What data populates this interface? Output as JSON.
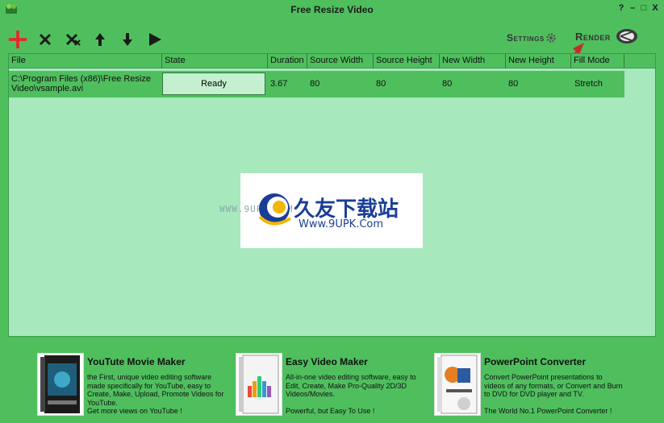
{
  "window": {
    "title": "Free Resize Video",
    "controls": [
      "?",
      "–",
      "□",
      "X"
    ]
  },
  "toolbar": {
    "buttons": [
      {
        "name": "add-icon",
        "color": "#e8282a"
      },
      {
        "name": "remove-icon"
      },
      {
        "name": "remove-all-icon"
      },
      {
        "name": "move-up-icon"
      },
      {
        "name": "move-down-icon"
      },
      {
        "name": "play-icon"
      }
    ],
    "settings_label": "Settings",
    "render_label": "Render"
  },
  "grid": {
    "columns": [
      "File",
      "State",
      "Duration",
      "Source Width",
      "Source Height",
      "New Width",
      "New Height",
      "Fill Mode"
    ],
    "rows": [
      {
        "file": "C:\\Program Files (x86)\\Free Resize Video\\vsample.avi",
        "state": "Ready",
        "duration": "3.67",
        "source_width": "80",
        "source_height": "80",
        "new_width": "80",
        "new_height": "80",
        "fill_mode": "Stretch"
      }
    ]
  },
  "watermark": {
    "small": "WWW.9UPK.COM",
    "cn": "久友下载站",
    "en": "Www.9UPK.Com"
  },
  "promos": [
    {
      "title": "YouTute Movie Maker",
      "desc": "the First, unique video editing software made specifically for YouTube, easy to Create, Make, Upload, Promote Videos for YouTube.",
      "foot": "Get more views on YouTube !"
    },
    {
      "title": "Easy Video Maker",
      "desc": "All-in-one video editing software, easy to Edit, Create, Make Pro-Quality 2D/3D Videos/Movies.",
      "foot": "Powerful, but Easy To Use !"
    },
    {
      "title": "PowerPoint Converter",
      "desc": "Convert PowerPoint presentations to videos of any formats, or Convert and Burn to DVD for DVD player and TV.",
      "foot": "The World No.1 PowerPoint Converter !"
    }
  ],
  "colors": {
    "background": "#4fbf5e",
    "grid_bg": "#a8e8bd",
    "annotation_arrow": "#c0302a"
  }
}
